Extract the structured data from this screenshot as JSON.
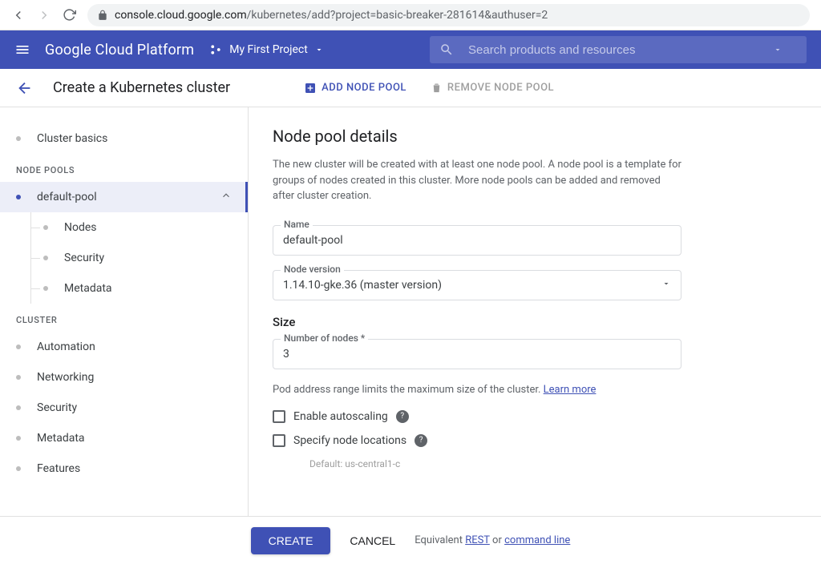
{
  "browser": {
    "url_domain": "console.cloud.google.com",
    "url_path": "/kubernetes/add?project=basic-breaker-281614&authuser=2"
  },
  "header": {
    "platform": "Google Cloud Platform",
    "project": "My First Project",
    "search_placeholder": "Search products and resources"
  },
  "subheader": {
    "title": "Create a Kubernetes cluster",
    "add_label": "ADD NODE POOL",
    "remove_label": "REMOVE NODE POOL"
  },
  "sidebar": {
    "cluster_basics": "Cluster basics",
    "heading_pools": "NODE POOLS",
    "pool_name": "default-pool",
    "sub_nodes": "Nodes",
    "sub_security": "Security",
    "sub_metadata": "Metadata",
    "heading_cluster": "CLUSTER",
    "automation": "Automation",
    "networking": "Networking",
    "security": "Security",
    "metadata": "Metadata",
    "features": "Features"
  },
  "main": {
    "title": "Node pool details",
    "desc": "The new cluster will be created with at least one node pool. A node pool is a template for groups of nodes created in this cluster. More node pools can be added and removed after cluster creation.",
    "name_label": "Name",
    "name_value": "default-pool",
    "version_label": "Node version",
    "version_value": "1.14.10-gke.36 (master version)",
    "size_heading": "Size",
    "nodes_label": "Number of nodes *",
    "nodes_value": "3",
    "helper_text": "Pod address range limits the maximum size of the cluster. ",
    "learn_more": "Learn more",
    "autoscale": "Enable autoscaling",
    "locations": "Specify node locations",
    "default_loc": "Default: us-central1-c"
  },
  "footer": {
    "create": "CREATE",
    "cancel": "CANCEL",
    "equiv_prefix": "Equivalent ",
    "rest": "REST",
    "or": " or ",
    "cmdline": "command line"
  }
}
